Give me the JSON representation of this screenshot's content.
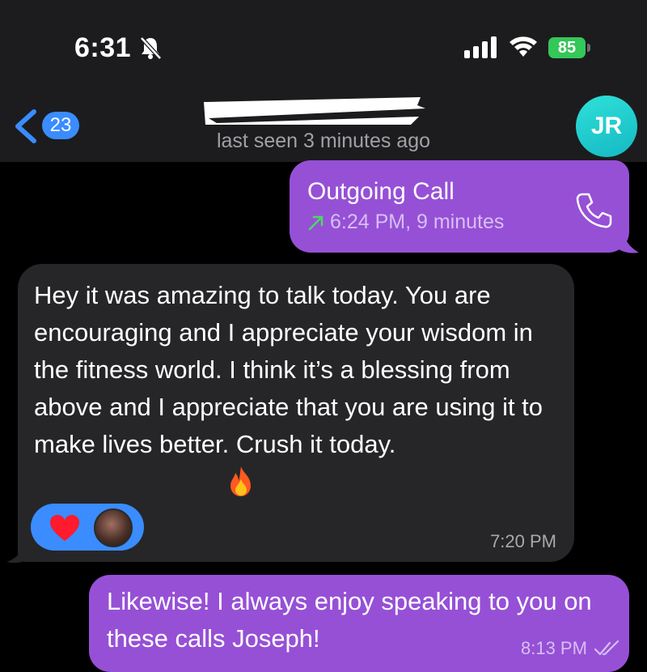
{
  "status_bar": {
    "time": "6:31",
    "battery": "85"
  },
  "header": {
    "back_count": "23",
    "last_seen": "last seen 3 minutes ago",
    "avatar_initials": "JR"
  },
  "messages": {
    "call": {
      "title": "Outgoing Call",
      "detail": "6:24 PM, 9 minutes"
    },
    "incoming": {
      "text": "Hey it was amazing to talk today. You are encouraging and I appreciate your wisdom in the fitness world. I think it’s a blessing from above and I appreciate that you are using it to make lives better. Crush it today.",
      "time": "7:20 PM",
      "reaction": "heart-icon"
    },
    "reply": {
      "text": "Likewise! I always enjoy speaking to you on these calls Joseph!",
      "time": "8:13 PM"
    }
  },
  "colors": {
    "outgoing_bubble": "#9650d6",
    "incoming_bubble": "#262628",
    "accent_blue": "#3a8cff",
    "avatar": "#20c9cf",
    "battery_green": "#34c759"
  }
}
